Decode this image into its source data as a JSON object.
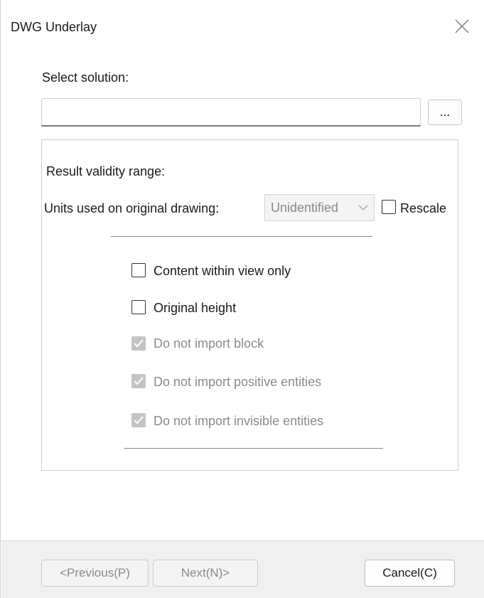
{
  "window": {
    "title": "DWG Underlay"
  },
  "solution": {
    "label": "Select solution:",
    "path_value": "",
    "browse_label": "..."
  },
  "group": {
    "validity_label": "Result validity range:",
    "units_label": "Units used on original drawing:",
    "units_value": "Unidentified",
    "rescale_label": "Rescale",
    "rescale_checked": false,
    "options": [
      {
        "label": "Content within view only",
        "checked": false,
        "enabled": true
      },
      {
        "label": "Original height",
        "checked": false,
        "enabled": true
      },
      {
        "label": "Do not import block",
        "checked": true,
        "enabled": false
      },
      {
        "label": "Do not import positive entities",
        "checked": true,
        "enabled": false
      },
      {
        "label": "Do not import invisible entities",
        "checked": true,
        "enabled": false
      }
    ]
  },
  "footer": {
    "previous_label": "<Previous(P)",
    "next_label": "Next(N)>",
    "cancel_label": "Cancel(C)"
  }
}
